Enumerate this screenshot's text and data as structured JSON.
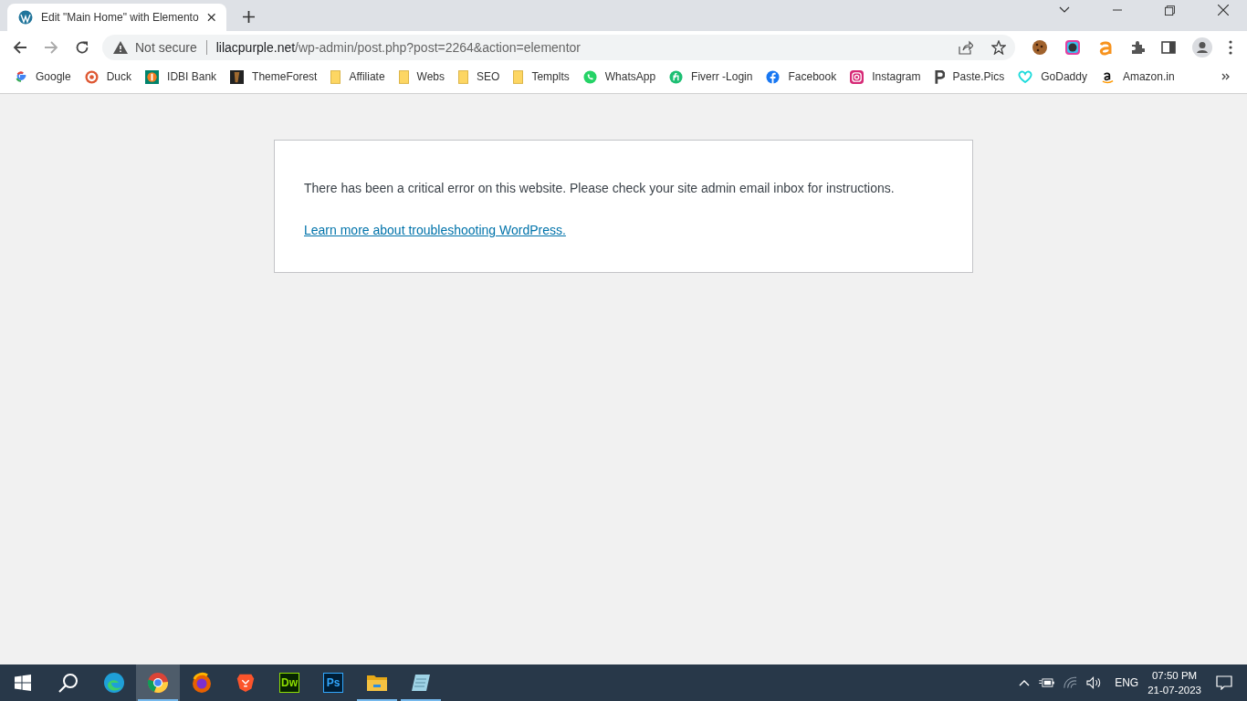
{
  "tabs": [
    {
      "title": "Edit \"Main Home\" with Elemento",
      "selected": true
    }
  ],
  "address_bar": {
    "security": "Not secure",
    "domain": "lilacpurple.net",
    "path": "/wp-admin/post.php?post=2264&action=elementor"
  },
  "bookmarks": [
    {
      "label": "Google",
      "kind": "google"
    },
    {
      "label": "Duck",
      "kind": "duck"
    },
    {
      "label": "IDBI Bank",
      "kind": "bank"
    },
    {
      "label": "ThemeForest",
      "kind": "dark"
    },
    {
      "label": "Affiliate",
      "kind": "folder"
    },
    {
      "label": "Webs",
      "kind": "folder"
    },
    {
      "label": "SEO",
      "kind": "folder"
    },
    {
      "label": "Templts",
      "kind": "folder"
    },
    {
      "label": "WhatsApp",
      "kind": "whatsapp"
    },
    {
      "label": "Fiverr -Login",
      "kind": "fiverr"
    },
    {
      "label": "Facebook",
      "kind": "facebook"
    },
    {
      "label": "Instagram",
      "kind": "instagram"
    },
    {
      "label": "Paste.Pics",
      "kind": "letter"
    },
    {
      "label": "GoDaddy",
      "kind": "godaddy"
    },
    {
      "label": "Amazon.in",
      "kind": "amazon"
    }
  ],
  "error": {
    "message": "There has been a critical error on this website. Please check your site admin email inbox for instructions.",
    "link": "Learn more about troubleshooting WordPress."
  },
  "taskbar": {
    "apps": [
      {
        "kind": "edge",
        "selected": false,
        "running": false
      },
      {
        "kind": "chrome",
        "selected": true,
        "running": true
      },
      {
        "kind": "firefox",
        "selected": false,
        "running": false
      },
      {
        "kind": "brave",
        "selected": false,
        "running": false
      },
      {
        "kind": "dw",
        "label": "Dw",
        "selected": false,
        "running": false
      },
      {
        "kind": "ps",
        "label": "Ps",
        "selected": false,
        "running": false
      },
      {
        "kind": "folder",
        "selected": false,
        "running": true
      },
      {
        "kind": "notepad",
        "selected": false,
        "running": true
      }
    ],
    "language": "ENG",
    "time": "07:50 PM",
    "date": "21-07-2023"
  }
}
